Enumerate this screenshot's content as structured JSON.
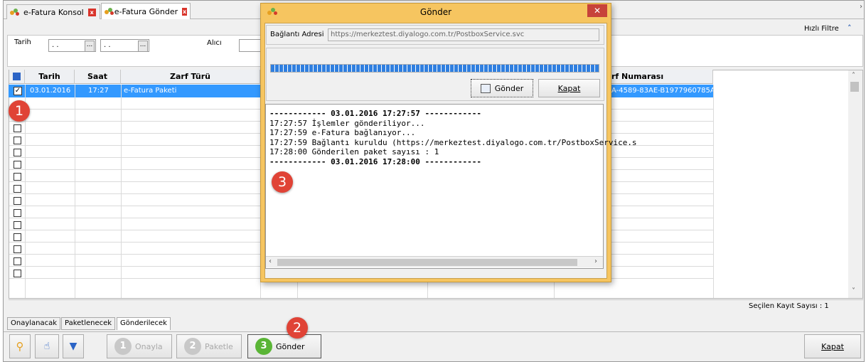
{
  "tabs": [
    {
      "label": "e-Fatura Konsol"
    },
    {
      "label": "e-Fatura Gönder"
    }
  ],
  "quick_filter": "Hızlı Filtre",
  "filters": {
    "date_label": "Tarih",
    "date_from": ". .",
    "date_to": ". .",
    "recipient_label": "Alıcı",
    "ellipsis": "..."
  },
  "grid": {
    "columns": [
      "Tarih",
      "Saat",
      "Zarf Türü",
      "rf Numarası"
    ],
    "rows": [
      {
        "checked": true,
        "date": "03.01.2016",
        "time": "17:27",
        "type": "e-Fatura Paketi",
        "number": "A-4589-83AE-B1977960785A"
      }
    ],
    "empty_rows": 15
  },
  "status": {
    "selected_count_label": "Seçilen Kayıt Sayısı : 1"
  },
  "bottom_tabs": [
    "Onaylanacak",
    "Paketlenecek",
    "Gönderilecek"
  ],
  "toolbar": {
    "approve": {
      "num": "1",
      "label": "Onayla"
    },
    "package": {
      "num": "2",
      "label": "Paketle"
    },
    "send": {
      "num": "3",
      "label": "Gönder"
    },
    "close": "Kapat"
  },
  "callouts": [
    "1",
    "2",
    "3"
  ],
  "dialog": {
    "title": "Gönder",
    "address_label": "Bağlantı Adresi",
    "address": "https://merkeztest.diyalogo.com.tr/PostboxService.svc",
    "progress": 1.0,
    "send_button": "Gönder",
    "close_button": "Kapat",
    "log": [
      {
        "text": "------------ 03.01.2016 17:27:57 ------------",
        "bold": true
      },
      {
        "text": "17:27:57 İşlemler gönderiliyor...",
        "bold": false
      },
      {
        "text": "17:27:59 e-Fatura bağlanıyor...",
        "bold": false
      },
      {
        "text": "17:27:59 Bağlantı kuruldu (https://merkeztest.diyalogo.com.tr/PostboxService.s",
        "bold": false
      },
      {
        "text": "17:28:00 Gönderilen paket sayısı : 1",
        "bold": false
      },
      {
        "text": "------------ 03.01.2016 17:28:00 ------------",
        "bold": true
      }
    ]
  },
  "colors": {
    "selection": "#3399ff",
    "callout": "#e04336",
    "dialog_frame": "#f6c560",
    "progress": "#2f7fe0"
  }
}
